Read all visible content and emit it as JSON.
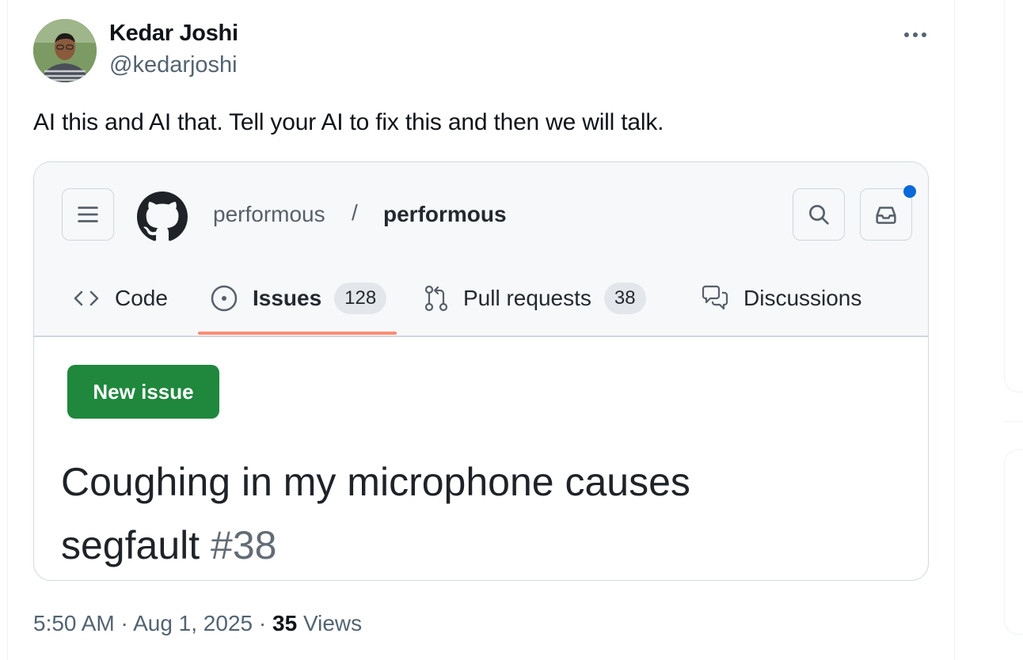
{
  "tweet": {
    "author": {
      "name": "Kedar Joshi",
      "handle": "@kedarjoshi"
    },
    "text": "AI this and AI that. Tell your AI to fix this and then we will talk.",
    "time": "5:50 AM",
    "date": "Aug 1, 2025",
    "views_count": "35",
    "views_label": "Views",
    "separator": "·"
  },
  "screenshot": {
    "repo_owner": "performous",
    "repo_separator": "/",
    "repo_name": "performous",
    "tabs": [
      {
        "label": "Code",
        "icon": "code-icon"
      },
      {
        "label": "Issues",
        "icon": "issue-opened-icon",
        "count": "128",
        "selected": true
      },
      {
        "label": "Pull requests",
        "icon": "git-pull-request-icon",
        "count": "38"
      },
      {
        "label": "Discussions",
        "icon": "comment-discussion-icon"
      }
    ],
    "new_issue_label": "New issue",
    "issue_title_line1": "Coughing in my microphone causes",
    "issue_title_line2": "segfault",
    "issue_number": "#38"
  },
  "colors": {
    "github_green": "#1f883d",
    "tab_underline": "#fd8c73",
    "notification_dot": "#0969da",
    "secondary_text": "#536471"
  }
}
